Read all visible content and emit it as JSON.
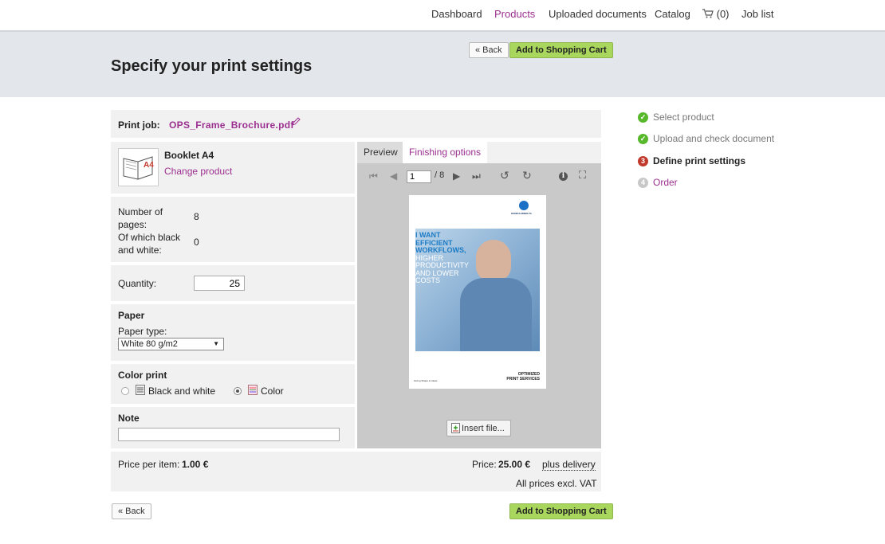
{
  "nav": {
    "items": [
      {
        "label": "Dashboard",
        "active": false
      },
      {
        "label": "Products",
        "active": true
      },
      {
        "label": "Uploaded documents",
        "active": false
      },
      {
        "label": "Catalog",
        "active": false
      }
    ],
    "cart": {
      "icon": "cart-icon",
      "count": "(0)"
    },
    "job_list": "Job list"
  },
  "header": {
    "title": "Specify your print settings",
    "back_label": "« Back",
    "cart_label": "Add to Shopping Cart"
  },
  "print_job": {
    "label": "Print job:",
    "filename": "OPS_Frame_Brochure.pdf",
    "edit_icon": "pencil-icon"
  },
  "product": {
    "name": "Booklet A4",
    "change_label": "Change product",
    "thumb_text": "A4"
  },
  "pages": {
    "number_label": "Number of pages:",
    "number_value": "8",
    "bw_label": "Of which black and white:",
    "bw_value": "0"
  },
  "quantity": {
    "label": "Quantity:",
    "value": "25"
  },
  "paper": {
    "title": "Paper",
    "type_label": "Paper type:",
    "selected": "White 80 g/m2"
  },
  "color_print": {
    "title": "Color print",
    "options": [
      {
        "label": "Black and white",
        "checked": false
      },
      {
        "label": "Color",
        "checked": true
      }
    ]
  },
  "note": {
    "title": "Note",
    "value": ""
  },
  "price": {
    "per_item_label": "Price per item:",
    "per_item_value": "1.00 €",
    "price_label": "Price:",
    "price_value": "25.00 €",
    "delivery_label": "plus delivery",
    "vat_note": "All prices excl. VAT"
  },
  "viewer": {
    "tabs": [
      {
        "label": "Preview",
        "active": true
      },
      {
        "label": "Finishing options",
        "active": false
      }
    ],
    "page_value": "1",
    "page_total": "/ 8",
    "insert_label": "Insert file...",
    "doc": {
      "headline_lines": [
        "I WANT",
        "EFFICIENT",
        "WORKFLOWS,"
      ],
      "sub_lines": [
        "HIGHER",
        "PRODUCTIVITY",
        "AND LOWER",
        "COSTS"
      ],
      "footer_left": "Giving Shape to Ideas",
      "footer_right_lines": [
        "OPTIMIZED",
        "PRINT SERVICES"
      ],
      "brand": "KONICA MINOLTA"
    }
  },
  "steps": [
    {
      "label": "Select product",
      "state": "done",
      "mark": "✓"
    },
    {
      "label": "Upload and check document",
      "state": "done",
      "mark": "✓"
    },
    {
      "label": "Define print settings",
      "state": "current",
      "mark": "3"
    },
    {
      "label": "Order",
      "state": "todo",
      "mark": "4"
    }
  ],
  "colors": {
    "accent": "#9b2f8f",
    "cart_green": "#a9d65c",
    "done_green": "#58b82b",
    "current_red": "#c0392b",
    "todo_grey": "#c8c8c8"
  }
}
